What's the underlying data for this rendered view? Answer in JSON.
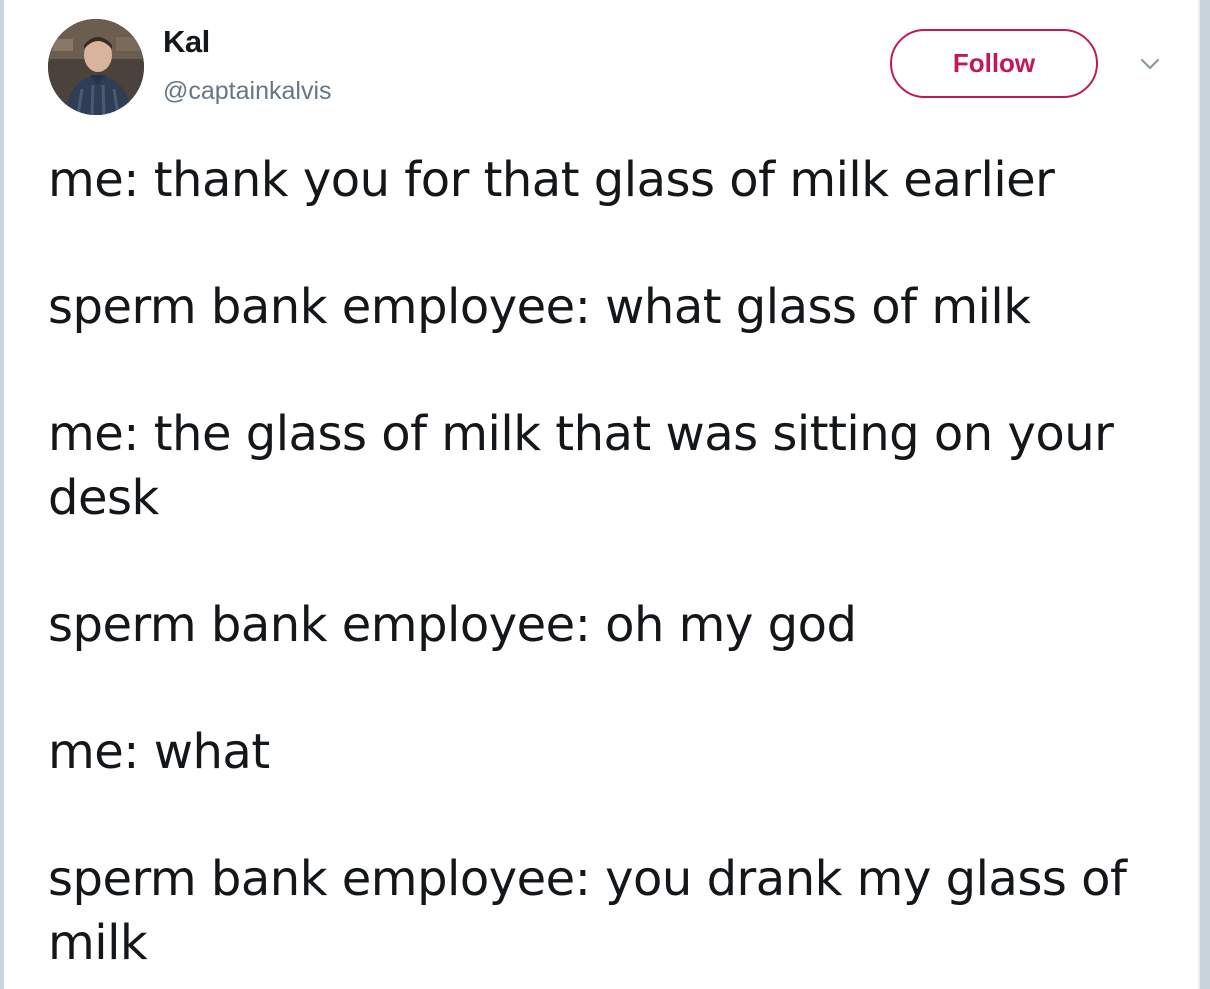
{
  "author": {
    "display_name": "Kal",
    "handle": "@captainkalvis"
  },
  "actions": {
    "follow_label": "Follow"
  },
  "tweet": {
    "lines": [
      "me: thank you for that glass of milk earlier",
      "sperm bank employee: what glass of milk",
      "me: the glass of milk that was sitting on your desk",
      "sperm bank employee: oh my god",
      "me: what",
      "sperm bank employee: you drank my glass of milk"
    ]
  },
  "colors": {
    "follow_accent": "#c2185b",
    "text": "#14171a",
    "secondary_text": "#657786"
  },
  "icons": {
    "menu": "chevron-down-icon"
  }
}
